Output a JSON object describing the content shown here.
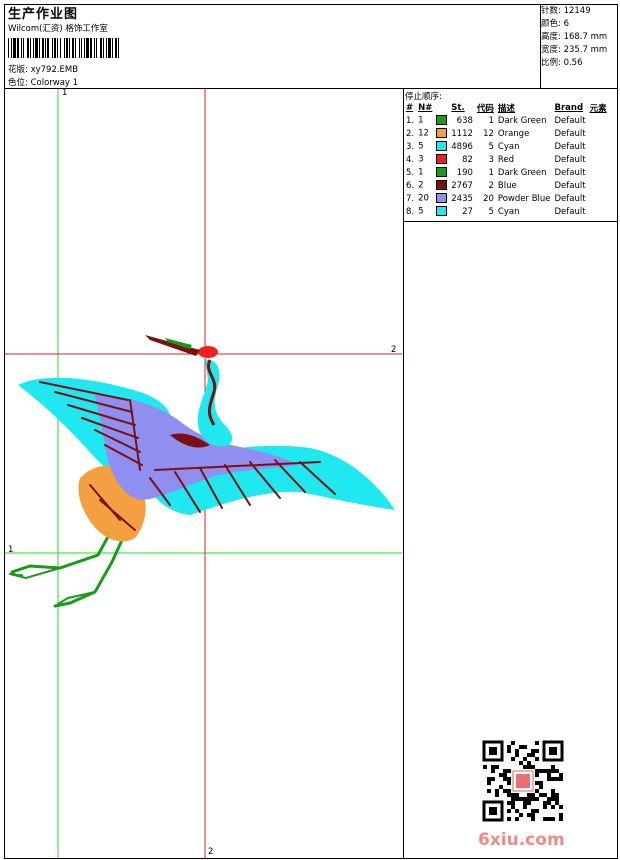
{
  "header": {
    "title": "生产作业图",
    "subtitle": "Wilcom(汇资) 格饰工作室",
    "design_line": "花版: xy792.EMB",
    "colorway_line": "色位: Colorway 1"
  },
  "stats": {
    "stitches": "针数: 12149",
    "colors": "颜色: 6",
    "height": "高度: 168.7 mm",
    "width": "宽度: 235.7 mm",
    "scale": "比例: 0.56"
  },
  "sequence": {
    "title": "停止顺序:",
    "headers": [
      "#",
      "N#",
      "St.",
      "代码",
      "描述",
      "Brand",
      "元素"
    ],
    "rows": [
      {
        "idx": "1.",
        "n": "1",
        "color": "#1a9a1a",
        "st": "638",
        "code": "1",
        "desc": "Dark Green",
        "brand": "Default"
      },
      {
        "idx": "2.",
        "n": "12",
        "color": "#f5a040",
        "st": "1112",
        "code": "12",
        "desc": "Orange",
        "brand": "Default"
      },
      {
        "idx": "3.",
        "n": "5",
        "color": "#20e8f0",
        "st": "4896",
        "code": "5",
        "desc": "Cyan",
        "brand": "Default"
      },
      {
        "idx": "4.",
        "n": "3",
        "color": "#ee2020",
        "st": "82",
        "code": "3",
        "desc": "Red",
        "brand": "Default"
      },
      {
        "idx": "5.",
        "n": "1",
        "color": "#1a9a1a",
        "st": "190",
        "code": "1",
        "desc": "Dark Green",
        "brand": "Default"
      },
      {
        "idx": "6.",
        "n": "2",
        "color": "#7a1010",
        "st": "2767",
        "code": "2",
        "desc": "Blue",
        "brand": "Default"
      },
      {
        "idx": "7.",
        "n": "20",
        "color": "#8f8ff0",
        "st": "2435",
        "code": "20",
        "desc": "Powder Blue",
        "brand": "Default"
      },
      {
        "idx": "8.",
        "n": "5",
        "color": "#20e8f0",
        "st": "27",
        "code": "5",
        "desc": "Cyan",
        "brand": "Default"
      }
    ]
  },
  "axes": {
    "v1_top": "1",
    "h2_right": "2",
    "h1_left": "1",
    "v2_bottom": "2"
  },
  "watermark": "6xiu.com"
}
